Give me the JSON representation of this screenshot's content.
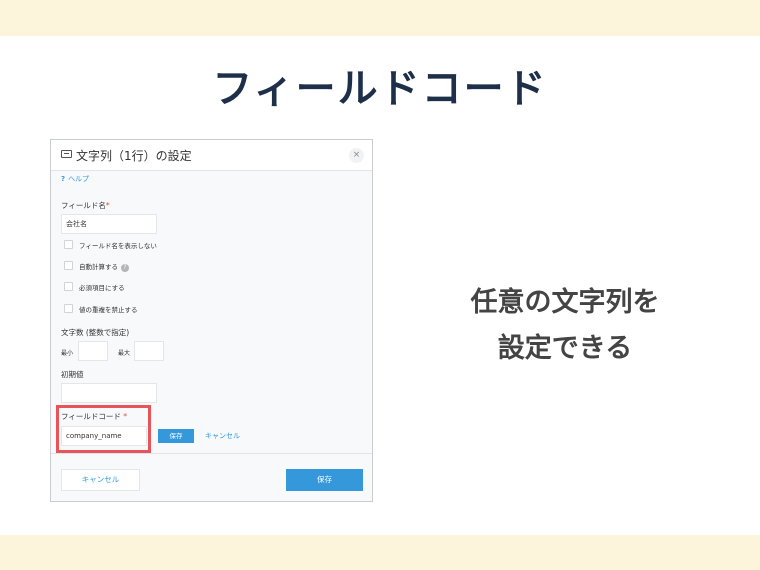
{
  "slide": {
    "title": "フィールドコード",
    "caption_line1": "任意の文字列を",
    "caption_line2": "設定できる"
  },
  "dialog": {
    "title": "文字列（1行）の設定",
    "close": "×",
    "help_mark": "?",
    "help_label": "ヘルプ",
    "field_name_label": "フィールド名",
    "required_mark": "*",
    "field_name_value": "会社名",
    "checkboxes": [
      {
        "label": "フィールド名を表示しない",
        "checked": false
      },
      {
        "label": "自動計算する",
        "checked": false,
        "has_help_icon": true
      },
      {
        "label": "必須項目にする",
        "checked": false
      },
      {
        "label": "値の重複を禁止する",
        "checked": false
      }
    ],
    "help_icon_glyph": "?",
    "char_count_label": "文字数 (整数で指定)",
    "min_label": "最小",
    "min_value": "",
    "max_label": "最大",
    "max_value": "",
    "default_label": "初期値",
    "default_value": "",
    "field_code_label": "フィールドコード",
    "field_code_value": "company_name",
    "field_code_save": "保存",
    "field_code_cancel": "キャンセル",
    "footer_cancel": "キャンセル",
    "footer_save": "保存"
  },
  "colors": {
    "accent": "#3498db",
    "highlight": "#e8545a",
    "band": "#fdf4dc",
    "title": "#1e2f4a"
  }
}
